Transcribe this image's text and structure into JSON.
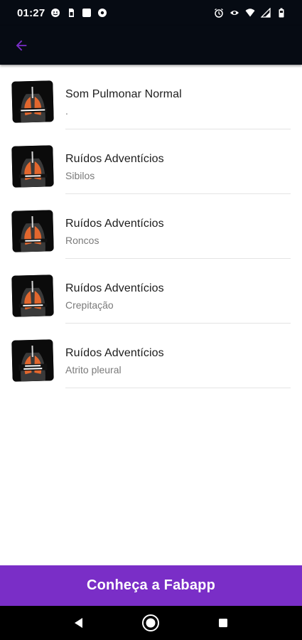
{
  "status_bar": {
    "time": "01:27",
    "left_icons": [
      "face-icon",
      "sim-icon",
      "square-notification-icon",
      "gear-notification-icon"
    ],
    "right_icons": [
      "alarm-icon",
      "eye-icon",
      "wifi-icon",
      "signal-icon",
      "battery-icon"
    ]
  },
  "app_bar": {
    "back_icon": "arrow-left-icon",
    "accent_color": "#7a2ec7"
  },
  "items": [
    {
      "title": "Som Pulmonar Normal",
      "subtitle": ".",
      "thumb_label": "SOM PULMONAR NORMAL"
    },
    {
      "title": "Ruídos Adventícios",
      "subtitle": "Sibilos",
      "thumb_label": "SIBILOS"
    },
    {
      "title": "Ruídos Adventícios",
      "subtitle": "Roncos",
      "thumb_label": "RONCOS"
    },
    {
      "title": "Ruídos Adventícios",
      "subtitle": "Crepitação",
      "thumb_label": "CREPITAÇÃO"
    },
    {
      "title": "Ruídos Adventícios",
      "subtitle": "Atrito pleural",
      "thumb_label": "ATRITO PLEURAL"
    }
  ],
  "cta": {
    "label": "Conheça a Fabapp",
    "color": "#7a2ec7"
  },
  "nav_bar": {
    "buttons": [
      "back-triangle-icon",
      "home-circle-icon",
      "recents-square-icon"
    ]
  }
}
